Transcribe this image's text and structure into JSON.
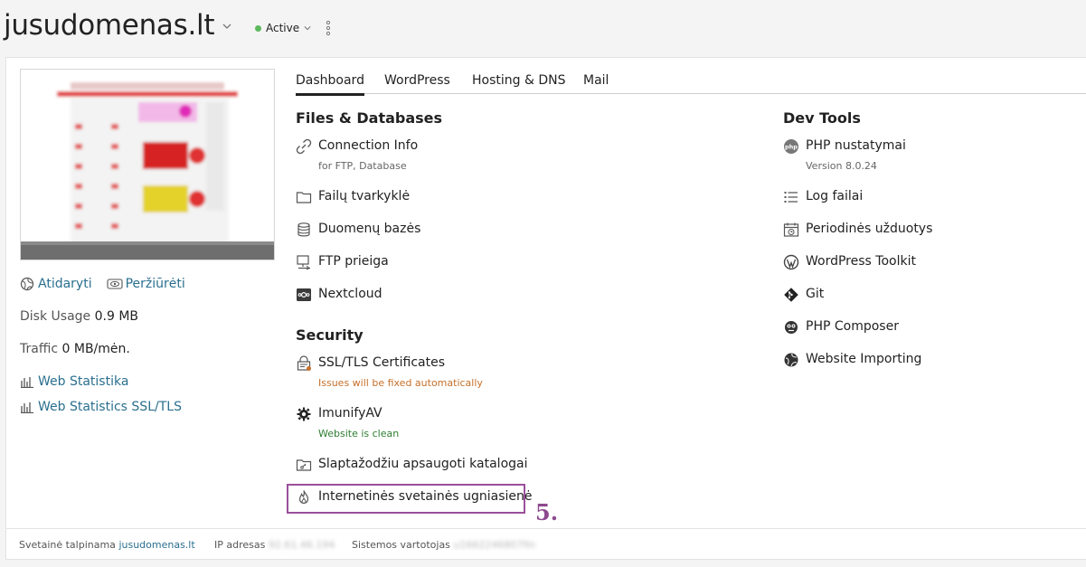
{
  "header": {
    "domain": "jusudomenas.lt",
    "status": "Active",
    "status_color": "#5cb85c"
  },
  "left": {
    "open_label": "Atidaryti",
    "preview_label": "Peržiūrėti",
    "disk_usage_label": "Disk Usage",
    "disk_usage_value": "0.9 MB",
    "traffic_label": "Traffic",
    "traffic_value": "0 MB/mėn.",
    "web_stats": "Web Statistika",
    "web_stats_ssl": "Web Statistics SSL/TLS"
  },
  "tabs": [
    "Dashboard",
    "WordPress",
    "Hosting & DNS",
    "Mail"
  ],
  "files": {
    "title": "Files & Databases",
    "connection_info": "Connection Info",
    "connection_info_sub": "for FTP, Database",
    "file_manager": "Failų tvarkyklė",
    "databases": "Duomenų bazės",
    "ftp": "FTP prieiga",
    "nextcloud": "Nextcloud"
  },
  "security": {
    "title": "Security",
    "ssl": "SSL/TLS Certificates",
    "ssl_sub": "Issues will be fixed automatically",
    "imunify": "ImunifyAV",
    "imunify_sub": "Website is clean",
    "password_dirs": "Slaptažodžiu apsaugoti katalogai",
    "firewall": "Internetinės svetainės ugniasienė"
  },
  "devtools": {
    "title": "Dev Tools",
    "php": "PHP nustatymai",
    "php_sub": "Version 8.0.24",
    "logs": "Log failai",
    "cron": "Periodinės užduotys",
    "wp_toolkit": "WordPress Toolkit",
    "git": "Git",
    "composer": "PHP Composer",
    "importing": "Website Importing"
  },
  "annotation": {
    "step": "5."
  },
  "footer": {
    "hosted_label": "Svetainė talpinama",
    "hosted_value": "jusudomenas.lt",
    "ip_label": "IP adresas",
    "ip_value": "92.61.46.194",
    "user_label": "Sistemos vartotojas",
    "user_value": "u1662246807fin"
  }
}
